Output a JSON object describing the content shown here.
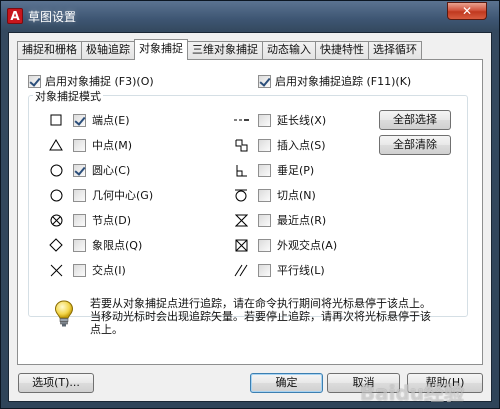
{
  "window": {
    "title": "草图设置",
    "close_label": "✕"
  },
  "tabs": [
    {
      "label": "捕捉和栅格",
      "active": false
    },
    {
      "label": "极轴追踪",
      "active": false
    },
    {
      "label": "对象捕捉",
      "active": true
    },
    {
      "label": "三维对象捕捉",
      "active": false
    },
    {
      "label": "动态输入",
      "active": false
    },
    {
      "label": "快捷特性",
      "active": false
    },
    {
      "label": "选择循环",
      "active": false
    }
  ],
  "panel": {
    "enable_osnap": {
      "label": "启用对象捕捉 (F3)(O)",
      "checked": true
    },
    "enable_tracking": {
      "label": "启用对象捕捉追踪 (F11)(K)",
      "checked": true
    },
    "group_title": "对象捕捉模式",
    "modes_left": [
      {
        "label": "端点(E)",
        "checked": true,
        "icon": "square-icon"
      },
      {
        "label": "中点(M)",
        "checked": false,
        "icon": "triangle-icon"
      },
      {
        "label": "圆心(C)",
        "checked": true,
        "icon": "circle-icon"
      },
      {
        "label": "几何中心(G)",
        "checked": false,
        "icon": "circle-icon"
      },
      {
        "label": "节点(D)",
        "checked": false,
        "icon": "node-icon"
      },
      {
        "label": "象限点(Q)",
        "checked": false,
        "icon": "diamond-icon"
      },
      {
        "label": "交点(I)",
        "checked": false,
        "icon": "cross-icon"
      }
    ],
    "modes_right": [
      {
        "label": "延长线(X)",
        "checked": false,
        "icon": "extension-icon"
      },
      {
        "label": "插入点(S)",
        "checked": false,
        "icon": "insert-icon"
      },
      {
        "label": "垂足(P)",
        "checked": false,
        "icon": "perpendicular-icon"
      },
      {
        "label": "切点(N)",
        "checked": false,
        "icon": "tangent-icon"
      },
      {
        "label": "最近点(R)",
        "checked": false,
        "icon": "nearest-icon"
      },
      {
        "label": "外观交点(A)",
        "checked": false,
        "icon": "apparent-intersection-icon"
      },
      {
        "label": "平行线(L)",
        "checked": false,
        "icon": "parallel-icon"
      }
    ],
    "select_all_label": "全部选择",
    "clear_all_label": "全部清除",
    "hint_text": "若要从对象捕捉点进行追踪，请在命令执行期间将光标悬停于该点上。当移动光标时会出现追踪矢量。若要停止追踪，请再次将光标悬停于该点上。"
  },
  "footer": {
    "options_label": "选项(T)...",
    "ok_label": "确定",
    "cancel_label": "取消",
    "help_label": "帮助(H)"
  },
  "watermark": "Baidu经验",
  "colors": {
    "accent_check": "#2b4e7a",
    "window_frame": "#34495f",
    "close_button": "#c0391f",
    "app_logo": "#c8161d"
  }
}
